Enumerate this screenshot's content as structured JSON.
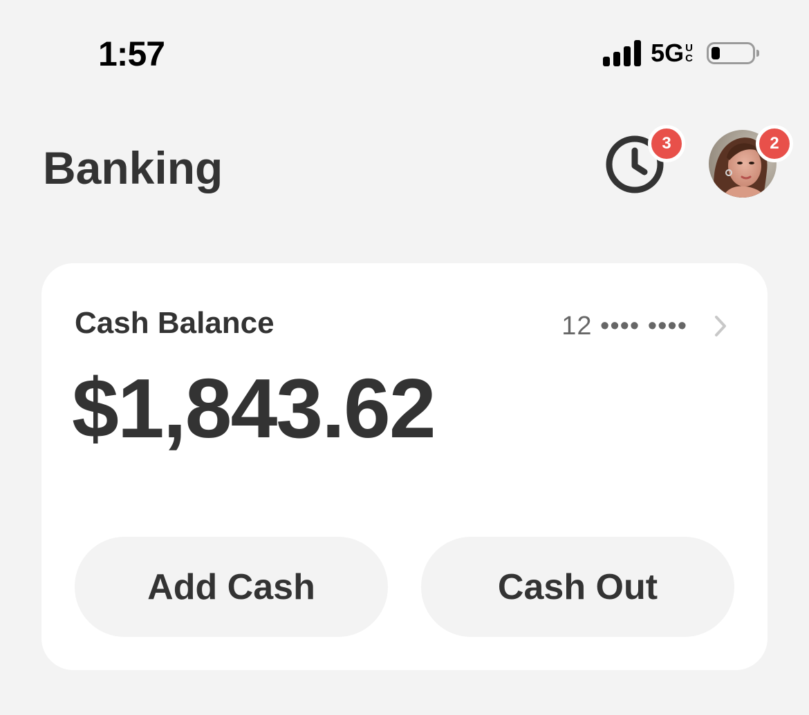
{
  "status_bar": {
    "time": "1:57",
    "network": "5G",
    "network_suffix_top": "U",
    "network_suffix_bottom": "C",
    "battery_level": 0.22
  },
  "header": {
    "title": "Banking",
    "activity_badge": "3",
    "profile_badge": "2"
  },
  "balance_card": {
    "label": "Cash Balance",
    "account_number": "12 •••• ••••",
    "amount": "$1,843.62",
    "add_cash_label": "Add Cash",
    "cash_out_label": "Cash Out"
  },
  "colors": {
    "background": "#f3f3f3",
    "card": "#ffffff",
    "text": "#333333",
    "badge": "#e8504a"
  },
  "icons": {
    "activity": "clock-icon",
    "account_link": "chevron-right-icon",
    "profile": "avatar"
  }
}
